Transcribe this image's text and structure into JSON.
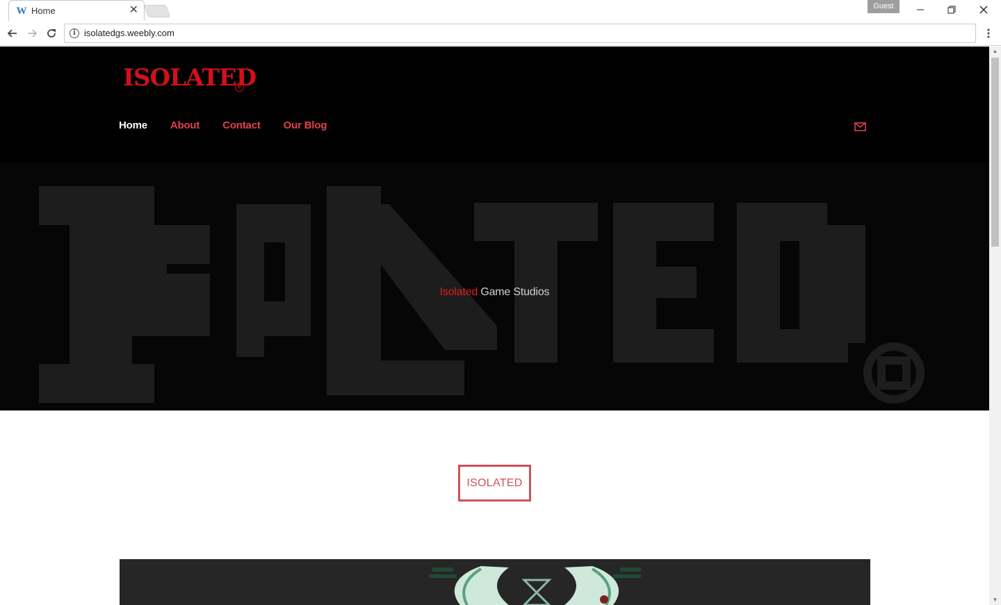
{
  "browser": {
    "tab_title": "Home",
    "tab_favicon": "W",
    "profile_label": "Guest",
    "url": "isolatedgs.weebly.com",
    "icons": {
      "back": "arrow-left-icon",
      "forward": "arrow-right-icon",
      "reload": "reload-icon",
      "info": "info-icon",
      "menu": "more-vert-icon",
      "minimize": "minimize-icon",
      "maximize": "restore-icon",
      "close": "close-icon"
    }
  },
  "site": {
    "logo_text": "ISOLATED",
    "logo_mark": "©",
    "nav": [
      {
        "label": "Home",
        "active": true
      },
      {
        "label": "About",
        "active": false
      },
      {
        "label": "Contact",
        "active": false
      },
      {
        "label": "Our Blog",
        "active": false
      }
    ],
    "hero": {
      "bg_text": "ISOLATED",
      "accent_word": "Isolated",
      "rest": " Game Studios"
    },
    "cta_label": "ISOLATED",
    "colors": {
      "accent": "#d0111b",
      "nav_link": "#e0404f",
      "button": "#d0505a",
      "header_bg": "#000000"
    }
  }
}
